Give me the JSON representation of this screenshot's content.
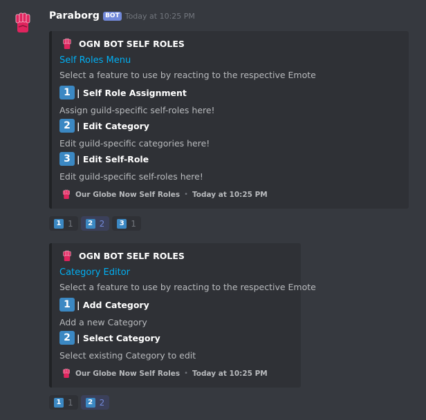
{
  "message": {
    "username": "Paraborg",
    "bot_badge": "BOT",
    "timestamp": "Today at 10:25 PM",
    "avatar_icon": "raised-fist-icon"
  },
  "embeds": [
    {
      "author": "OGN BOT SELF ROLES",
      "title": "Self Roles Menu",
      "description": "Select a feature to use by reacting to the respective Emote",
      "fields": [
        {
          "key": "1",
          "name": "| Self Role Assignment",
          "value": "Assign guild-specific self-roles here!"
        },
        {
          "key": "2",
          "name": "| Edit Category",
          "value": "Edit guild-specific categories here!"
        },
        {
          "key": "3",
          "name": "| Edit Self-Role",
          "value": "Edit guild-specific self-roles here!"
        }
      ],
      "footer": {
        "text": "Our Globe Now Self Roles",
        "separator": "•",
        "timestamp": "Today at 10:25 PM"
      }
    },
    {
      "author": "OGN BOT SELF ROLES",
      "title": "Category Editor",
      "description": "Select a feature to use by reacting to the respective Emote",
      "fields": [
        {
          "key": "1",
          "name": "| Add Category",
          "value": "Add a new Category"
        },
        {
          "key": "2",
          "name": "| Select Category",
          "value": "Select existing Category to edit"
        }
      ],
      "footer": {
        "text": "Our Globe Now Self Roles",
        "separator": "•",
        "timestamp": "Today at 10:25 PM"
      }
    }
  ],
  "reactions": [
    [
      {
        "key": "1",
        "count": "1",
        "me": false
      },
      {
        "key": "2",
        "count": "2",
        "me": true
      },
      {
        "key": "3",
        "count": "1",
        "me": false
      }
    ],
    [
      {
        "key": "1",
        "count": "1",
        "me": false
      },
      {
        "key": "2",
        "count": "2",
        "me": true
      }
    ]
  ],
  "colors": {
    "background": "#36393f",
    "embed": "#2f3136",
    "title_link": "#00b0f4",
    "keycap": "#3b88c3",
    "bot_badge": "#7289da"
  }
}
